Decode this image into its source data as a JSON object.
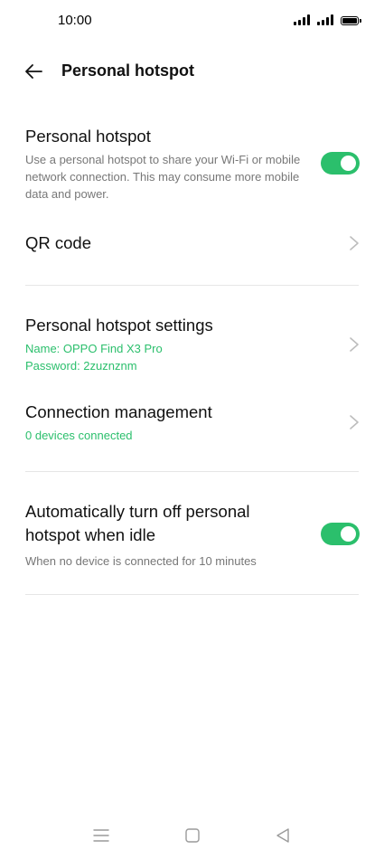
{
  "status_bar": {
    "time": "10:00"
  },
  "header": {
    "title": "Personal hotspot",
    "back_icon": "arrow-left-icon"
  },
  "hotspot": {
    "title": "Personal hotspot",
    "description": "Use a personal hotspot to share your Wi-Fi or mobile network connection. This may consume more mobile data and power.",
    "enabled": true
  },
  "qr_code": {
    "title": "QR code"
  },
  "hotspot_settings": {
    "title": "Personal hotspot settings",
    "name_line": "Name: OPPO Find X3 Pro",
    "password_line": "Password: 2zuznznm"
  },
  "connection_management": {
    "title": "Connection management",
    "subtitle": "0 devices connected"
  },
  "auto_off": {
    "title": "Automatically turn off personal hotspot when idle",
    "description": "When no device is connected for 10 minutes",
    "enabled": true
  },
  "colors": {
    "accent": "#2bbf6c",
    "text": "#111111",
    "secondary_text": "#777777",
    "divider": "#e6e6e6"
  },
  "nav_bar": {
    "menu_icon": "menu-icon",
    "home_icon": "home-square-icon",
    "back_icon": "back-triangle-icon"
  }
}
